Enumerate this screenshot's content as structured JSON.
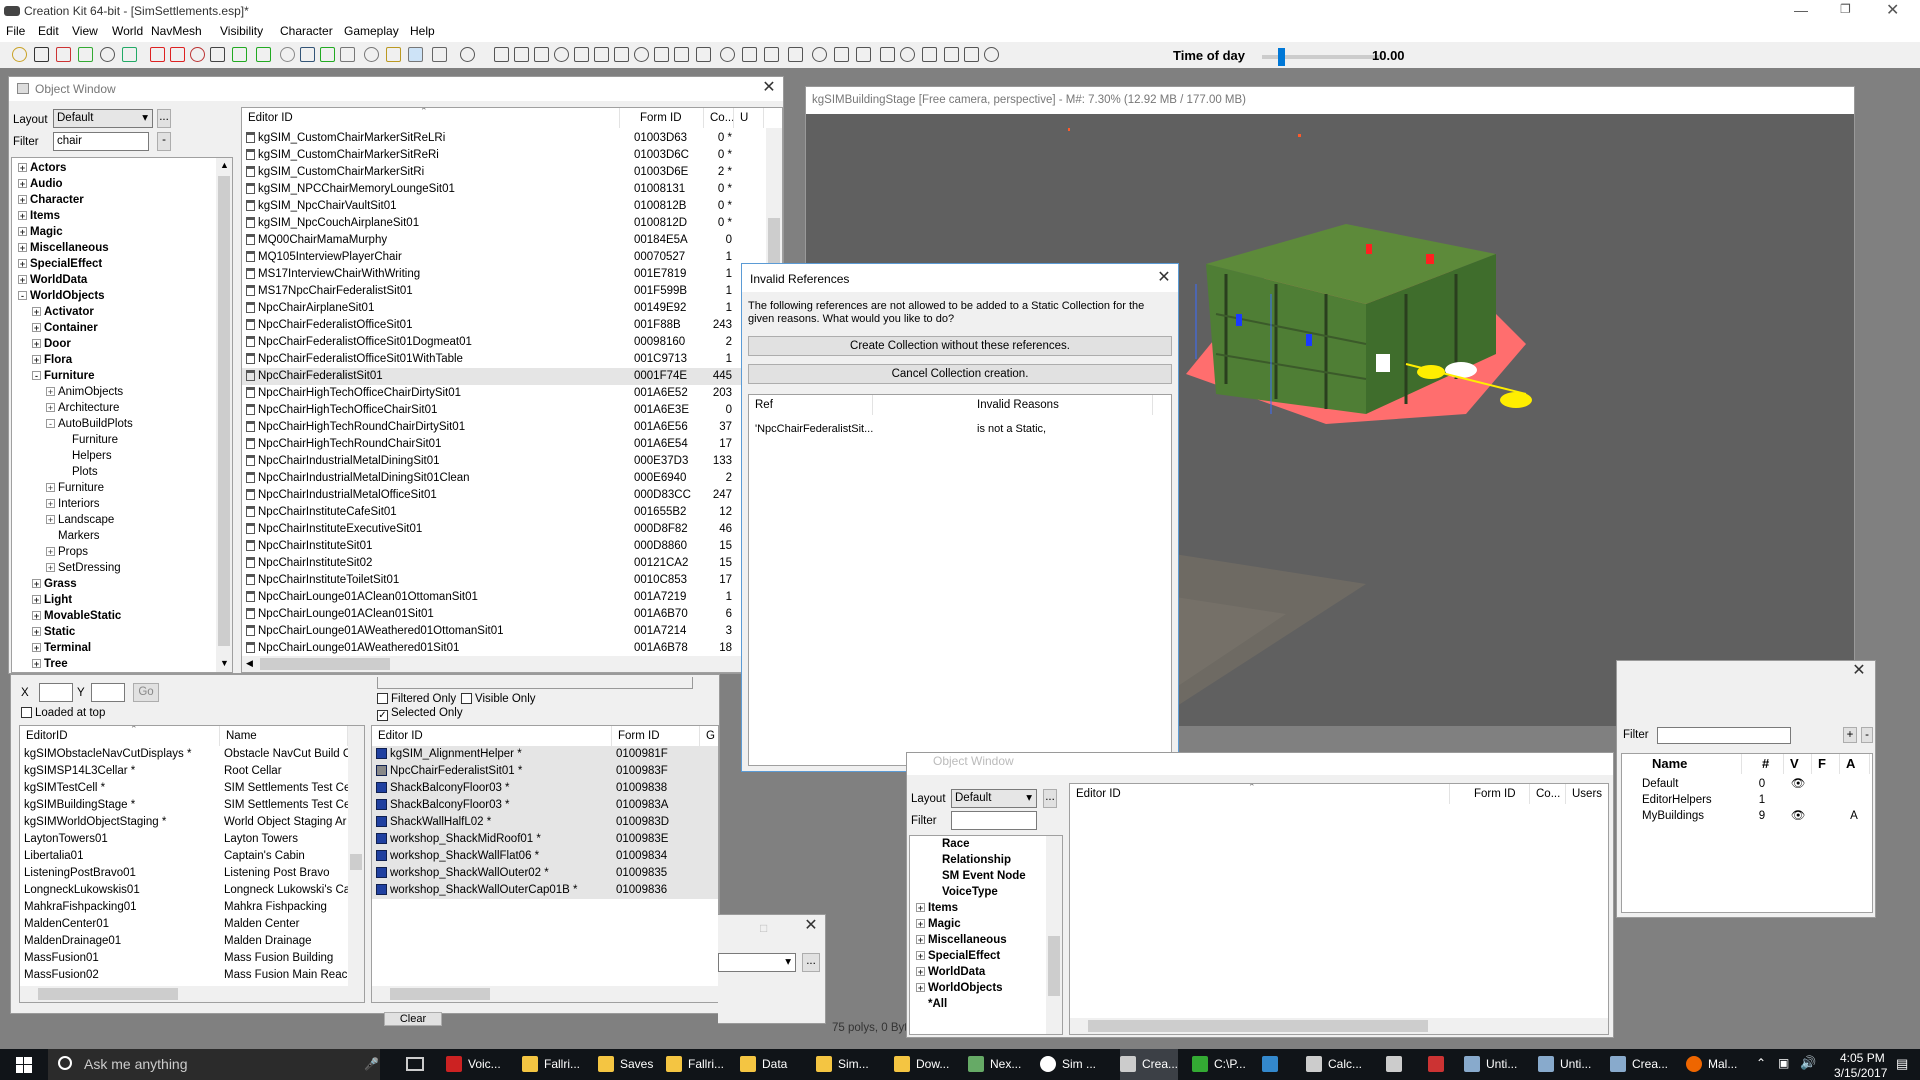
{
  "app": {
    "title": "Creation Kit 64-bit - [SimSettlements.esp]*",
    "menu": [
      "File",
      "Edit",
      "View",
      "World",
      "NavMesh",
      "Visibility",
      "Character",
      "Gameplay",
      "Help"
    ],
    "time_of_day_label": "Time of day",
    "time_of_day_value": "10.00",
    "time_of_day_fraction": 0.13
  },
  "object_window": {
    "title": "Object Window",
    "layout_label": "Layout",
    "layout_value": "Default",
    "filter_label": "Filter",
    "filter_value": "chair",
    "filter_button": "-",
    "layout_button": "...",
    "columns": [
      "Editor ID",
      "Form ID",
      "Co...",
      "U"
    ],
    "rows": [
      [
        "kgSIM_CustomChairMarkerSitReLRi",
        "01003D63",
        "0 *"
      ],
      [
        "kgSIM_CustomChairMarkerSitReRi",
        "01003D6C",
        "0 *"
      ],
      [
        "kgSIM_CustomChairMarkerSitRi",
        "01003D6E",
        "2 *"
      ],
      [
        "kgSIM_NPCChairMemoryLoungeSit01",
        "01008131",
        "0 *"
      ],
      [
        "kgSIM_NpcChairVaultSit01",
        "0100812B",
        "0 *"
      ],
      [
        "kgSIM_NpcCouchAirplaneSit01",
        "0100812D",
        "0 *"
      ],
      [
        "MQ00ChairMamaMurphy",
        "00184E5A",
        "0"
      ],
      [
        "MQ105InterviewPlayerChair",
        "00070527",
        "1"
      ],
      [
        "MS17InterviewChairWithWriting",
        "001E7819",
        "1"
      ],
      [
        "MS17NpcChairFederalistSit01",
        "001F599B",
        "1"
      ],
      [
        "NpcChairAirplaneSit01",
        "00149E92",
        "1"
      ],
      [
        "NpcChairFederalistOfficeSit01",
        "001F88B",
        "243"
      ],
      [
        "NpcChairFederalistOfficeSit01Dogmeat01",
        "00098160",
        "2"
      ],
      [
        "NpcChairFederalistOfficeSit01WithTable",
        "001C9713",
        "1"
      ],
      [
        "NpcChairFederalistSit01",
        "0001F74E",
        "445"
      ],
      [
        "NpcChairHighTechOfficeChairDirtySit01",
        "001A6E52",
        "203"
      ],
      [
        "NpcChairHighTechOfficeChairSit01",
        "001A6E3E",
        "0"
      ],
      [
        "NpcChairHighTechRoundChairDirtySit01",
        "001A6E56",
        "37"
      ],
      [
        "NpcChairHighTechRoundChairSit01",
        "001A6E54",
        "17"
      ],
      [
        "NpcChairIndustrialMetalDiningSit01",
        "000E37D3",
        "133"
      ],
      [
        "NpcChairIndustrialMetalDiningSit01Clean",
        "000E6940",
        "2"
      ],
      [
        "NpcChairIndustrialMetalOfficeSit01",
        "000D83CC",
        "247"
      ],
      [
        "NpcChairInstituteCafeSit01",
        "001655B2",
        "12"
      ],
      [
        "NpcChairInstituteExecutiveSit01",
        "000D8F82",
        "46"
      ],
      [
        "NpcChairInstituteSit01",
        "000D8860",
        "15"
      ],
      [
        "NpcChairInstituteSit02",
        "00121CA2",
        "15"
      ],
      [
        "NpcChairInstituteToiletSit01",
        "0010C853",
        "17"
      ],
      [
        "NpcChairLounge01AClean01OttomanSit01",
        "001A7219",
        "1"
      ],
      [
        "NpcChairLounge01AClean01Sit01",
        "001A6B70",
        "6"
      ],
      [
        "NpcChairLounge01AWeathered01OttomanSit01",
        "001A7214",
        "3"
      ],
      [
        "NpcChairLounge01AWeathered01Sit01",
        "001A6B78",
        "18"
      ]
    ],
    "tree": [
      {
        "label": "Actors",
        "level": 0,
        "exp": "+",
        "bold": true
      },
      {
        "label": "Audio",
        "level": 0,
        "exp": "+",
        "bold": true
      },
      {
        "label": "Character",
        "level": 0,
        "exp": "+",
        "bold": true
      },
      {
        "label": "Items",
        "level": 0,
        "exp": "+",
        "bold": true
      },
      {
        "label": "Magic",
        "level": 0,
        "exp": "+",
        "bold": true
      },
      {
        "label": "Miscellaneous",
        "level": 0,
        "exp": "+",
        "bold": true
      },
      {
        "label": "SpecialEffect",
        "level": 0,
        "exp": "+",
        "bold": true
      },
      {
        "label": "WorldData",
        "level": 0,
        "exp": "+",
        "bold": true
      },
      {
        "label": "WorldObjects",
        "level": 0,
        "exp": "-",
        "bold": true
      },
      {
        "label": "Activator",
        "level": 1,
        "exp": "+",
        "bold": true
      },
      {
        "label": "Container",
        "level": 1,
        "exp": "+",
        "bold": true
      },
      {
        "label": "Door",
        "level": 1,
        "exp": "+",
        "bold": true
      },
      {
        "label": "Flora",
        "level": 1,
        "exp": "+",
        "bold": true
      },
      {
        "label": "Furniture",
        "level": 1,
        "exp": "-",
        "bold": true
      },
      {
        "label": "AnimObjects",
        "level": 2,
        "exp": "+",
        "bold": false
      },
      {
        "label": "Architecture",
        "level": 2,
        "exp": "+",
        "bold": false
      },
      {
        "label": "AutoBuildPlots",
        "level": 2,
        "exp": "-",
        "bold": false
      },
      {
        "label": "Furniture",
        "level": 3,
        "exp": "",
        "bold": false
      },
      {
        "label": "Helpers",
        "level": 3,
        "exp": "",
        "bold": false
      },
      {
        "label": "Plots",
        "level": 3,
        "exp": "",
        "bold": false
      },
      {
        "label": "Furniture",
        "level": 2,
        "exp": "+",
        "bold": false
      },
      {
        "label": "Interiors",
        "level": 2,
        "exp": "+",
        "bold": false
      },
      {
        "label": "Landscape",
        "level": 2,
        "exp": "+",
        "bold": false
      },
      {
        "label": "Markers",
        "level": 2,
        "exp": "",
        "bold": false
      },
      {
        "label": "Props",
        "level": 2,
        "exp": "+",
        "bold": false
      },
      {
        "label": "SetDressing",
        "level": 2,
        "exp": "+",
        "bold": false
      },
      {
        "label": "Grass",
        "level": 1,
        "exp": "+",
        "bold": true
      },
      {
        "label": "Light",
        "level": 1,
        "exp": "+",
        "bold": true
      },
      {
        "label": "MovableStatic",
        "level": 1,
        "exp": "+",
        "bold": true
      },
      {
        "label": "Static",
        "level": 1,
        "exp": "+",
        "bold": true
      },
      {
        "label": "Terminal",
        "level": 1,
        "exp": "+",
        "bold": true
      },
      {
        "label": "Tree",
        "level": 1,
        "exp": "+",
        "bold": true
      }
    ],
    "tree_partial": "*All"
  },
  "render_window": {
    "title": "kgSIMBuildingStage [Free camera, perspective] - M#: 7.30% (12.92 MB / 177.00 MB)"
  },
  "dialog": {
    "title": "Invalid References",
    "message": "The following references are not allowed to be added to a Static Collection for the given reasons. What would you like to do?",
    "btn_create": "Create Collection without these references.",
    "btn_cancel": "Cancel Collection creation.",
    "col_ref": "Ref",
    "col_reasons": "Invalid Reasons",
    "row_ref": "'NpcChairFederalistSit...",
    "row_reason": "is not a Static,"
  },
  "cell_view": {
    "x_label": "X",
    "y_label": "Y",
    "go": "Go",
    "loaded_at_top": "Loaded at top",
    "columns": [
      "EditorID",
      "Name"
    ],
    "rows": [
      [
        "kgSIMObstacleNavCutDisplays *",
        "Obstacle NavCut Build C"
      ],
      [
        "kgSIMSP14L3Cellar *",
        "Root Cellar"
      ],
      [
        "kgSIMTestCell *",
        "SIM Settlements Test Ce"
      ],
      [
        "kgSIMBuildingStage *",
        "SIM Settlements Test Ce"
      ],
      [
        "kgSIMWorldObjectStaging *",
        "World Object Staging Ar"
      ],
      [
        "LaytonTowers01",
        "Layton Towers"
      ],
      [
        "Libertalia01",
        "Captain's Cabin"
      ],
      [
        "ListeningPostBravo01",
        "Listening Post Bravo"
      ],
      [
        "LongneckLukowskis01",
        "Longneck Lukowski's Ca"
      ],
      [
        "MahkraFishpacking01",
        "Mahkra Fishpacking"
      ],
      [
        "MaldenCenter01",
        "Malden Center"
      ],
      [
        "MaldenDrainage01",
        "Malden Drainage"
      ],
      [
        "MassFusion01",
        "Mass Fusion Building"
      ],
      [
        "MassFusion02",
        "Mass Fusion Main Reac"
      ]
    ],
    "filtered_only": "Filtered Only",
    "visible_only": "Visible Only",
    "selected_only": "Selected Only",
    "ref_columns": [
      "Editor ID",
      "Form ID",
      "G"
    ],
    "ref_rows": [
      [
        "kgSIM_AlignmentHelper *",
        "0100981F"
      ],
      [
        "NpcChairFederalistSit01 *",
        "0100983F"
      ],
      [
        "ShackBalconyFloor03 *",
        "01009838"
      ],
      [
        "ShackBalconyFloor03 *",
        "0100983A"
      ],
      [
        "ShackWallHalfL02 *",
        "0100983D"
      ],
      [
        "workshop_ShackMidRoof01 *",
        "0100983E"
      ],
      [
        "workshop_ShackWallFlat06 *",
        "01009834"
      ],
      [
        "workshop_ShackWallOuter02 *",
        "01009835"
      ],
      [
        "workshop_ShackWallOuterCap01B *",
        "01009836"
      ]
    ],
    "clear": "Clear"
  },
  "small_dialog": {
    "button": "..."
  },
  "object_window2": {
    "title": "Object Window",
    "layout_label": "Layout",
    "layout_value": "Default",
    "filter_label": "Filter",
    "layout_button": "...",
    "columns": [
      "Editor ID",
      "Form ID",
      "Co...",
      "Users"
    ],
    "tree": [
      {
        "label": "Race",
        "level": 1,
        "exp": "",
        "bold": true
      },
      {
        "label": "Relationship",
        "level": 1,
        "exp": "",
        "bold": true
      },
      {
        "label": "SM Event Node",
        "level": 1,
        "exp": "",
        "bold": true
      },
      {
        "label": "VoiceType",
        "level": 1,
        "exp": "",
        "bold": true
      },
      {
        "label": "Items",
        "level": 0,
        "exp": "+",
        "bold": true
      },
      {
        "label": "Magic",
        "level": 0,
        "exp": "+",
        "bold": true
      },
      {
        "label": "Miscellaneous",
        "level": 0,
        "exp": "+",
        "bold": true
      },
      {
        "label": "SpecialEffect",
        "level": 0,
        "exp": "+",
        "bold": true
      },
      {
        "label": "WorldData",
        "level": 0,
        "exp": "+",
        "bold": true
      },
      {
        "label": "WorldObjects",
        "level": 0,
        "exp": "+",
        "bold": true
      },
      {
        "label": "*All",
        "level": 0,
        "exp": "",
        "bold": true
      }
    ]
  },
  "layers": {
    "filter_label": "Filter",
    "add": "+",
    "remove": "-",
    "columns": [
      "Name",
      "#",
      "V",
      "F",
      "A"
    ],
    "rows": [
      {
        "name": "Default",
        "count": "0",
        "visible": "",
        "a": ""
      },
      {
        "name": "EditorHelpers",
        "count": "1",
        "visible": "",
        "a": ""
      },
      {
        "name": "MyBuildings",
        "count": "9",
        "visible": "👁",
        "a": "A"
      }
    ],
    "visible_default": "👁"
  },
  "status": {
    "polys": "75 polys, 0 Byt"
  },
  "taskbar": {
    "search": "Ask me anything",
    "items": [
      "Voic...",
      "Fallri...",
      "Saves",
      "Fallri...",
      "Data",
      "Sim...",
      "Dow...",
      "Nex...",
      "Sim ...",
      "Crea...",
      "C:\\P...",
      "",
      "Calc...",
      "",
      "",
      "Unti...",
      "Unti...",
      "Crea...",
      "Mal..."
    ],
    "time": "4:05 PM",
    "date": "3/15/2017"
  },
  "colors": {
    "accent_blue": "#0078d7",
    "viewport_bg": "#606060",
    "taskbar_bg": "#101418",
    "selected_row": "#e5e5e5"
  }
}
